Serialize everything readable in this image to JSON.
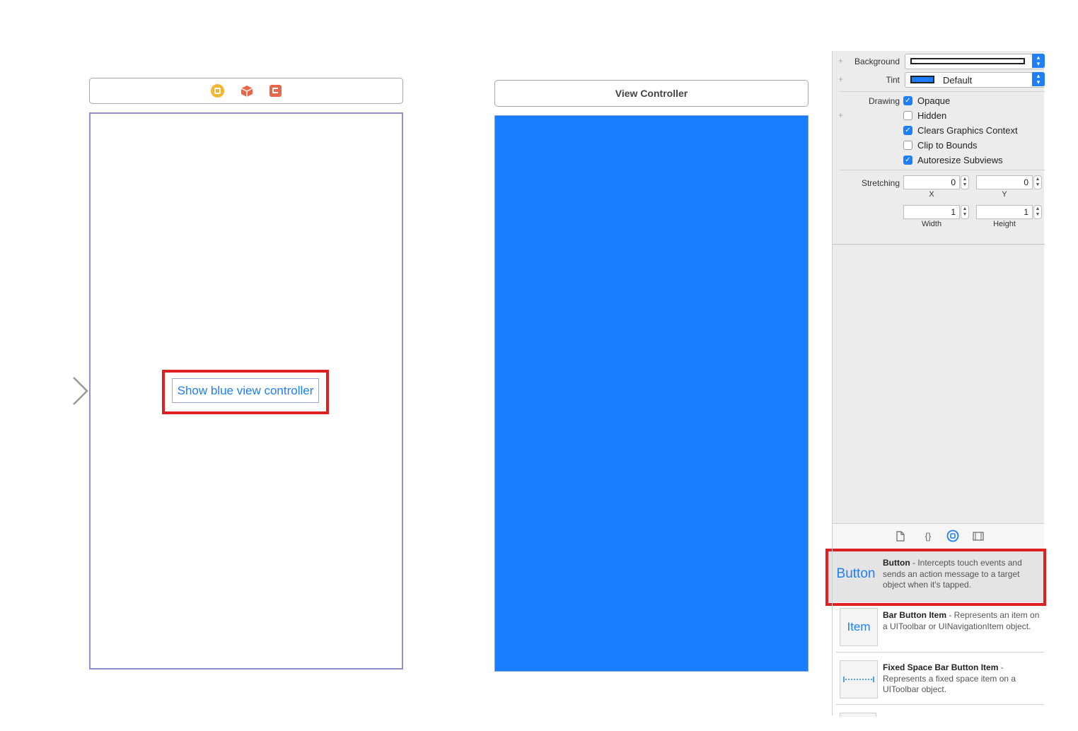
{
  "scene1": {
    "icons": [
      "view-controller-icon",
      "first-responder-icon",
      "exit-icon"
    ],
    "button_label": "Show blue view controller"
  },
  "scene2": {
    "title": "View Controller",
    "view_color": "#1a7dff"
  },
  "inspector": {
    "background": {
      "label": "Background",
      "value_color": "#ffffff"
    },
    "tint": {
      "label": "Tint",
      "value": "Default",
      "value_color": "#1a7dff"
    },
    "drawing": {
      "label": "Drawing",
      "options": [
        {
          "label": "Opaque",
          "checked": true
        },
        {
          "label": "Hidden",
          "checked": false
        },
        {
          "label": "Clears Graphics Context",
          "checked": true
        },
        {
          "label": "Clip to Bounds",
          "checked": false
        },
        {
          "label": "Autoresize Subviews",
          "checked": true
        }
      ]
    },
    "stretching": {
      "label": "Stretching",
      "x": "0",
      "y": "0",
      "width": "1",
      "height": "1",
      "x_label": "X",
      "y_label": "Y",
      "width_label": "Width",
      "height_label": "Height"
    }
  },
  "library": {
    "tabs": [
      "file-template-icon",
      "code-snippet-icon",
      "object-library-icon",
      "media-library-icon"
    ],
    "selected_tab": "object-library-icon",
    "items": [
      {
        "icon_text": "Button",
        "title": "Button",
        "description": " - Intercepts touch events and sends an action message to a target object when it's tapped."
      },
      {
        "icon_text": "Item",
        "title": "Bar Button Item",
        "description": " - Represents an item on a UIToolbar or UINavigationItem object."
      },
      {
        "icon_text": "",
        "title": "Fixed Space Bar Button Item",
        "description": " - Represents a fixed space item on a UIToolbar object."
      }
    ]
  },
  "colors": {
    "accent": "#1e7ff6",
    "highlight": "#e02020"
  }
}
